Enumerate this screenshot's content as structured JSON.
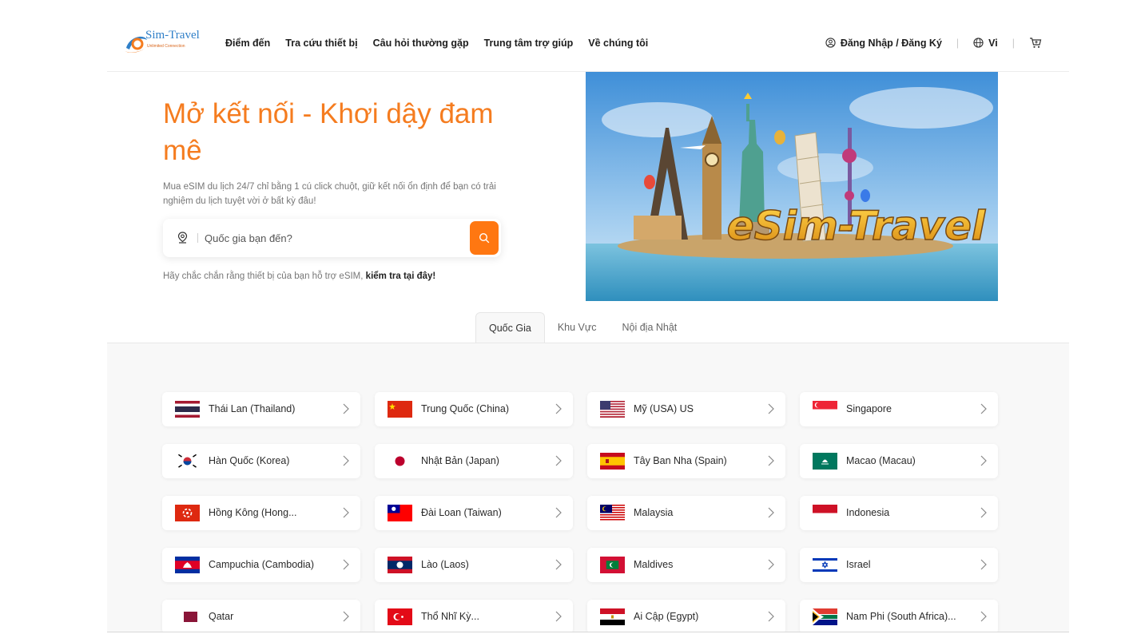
{
  "brand": {
    "name": "Sim-Travel",
    "tagline": "Unlimited Connection"
  },
  "nav": [
    "Điểm đến",
    "Tra cứu thiết bị",
    "Câu hỏi thường gặp",
    "Trung tâm trợ giúp",
    "Về chúng tôi"
  ],
  "header": {
    "login": "Đăng Nhập / Đăng Ký",
    "language": "Vi",
    "sep": "|"
  },
  "hero": {
    "title": "Mở kết nối - Khơi dậy đam mê",
    "description": "Mua eSIM du lịch 24/7 chỉ bằng 1 cú click chuột, giữ kết nối ổn định để bạn có trải nghiệm du lịch tuyệt vời ở bất kỳ đâu!",
    "search_placeholder": "Quốc gia bạn đến?",
    "hint_text": "Hãy chắc chắn rằng thiết bị của bạn hỗ trợ eSIM,",
    "hint_link": "kiểm tra tại đây!",
    "banner_text": "eSim-Travel"
  },
  "tabs": [
    {
      "label": "Quốc Gia",
      "active": true
    },
    {
      "label": "Khu Vực",
      "active": false
    },
    {
      "label": "Nội địa Nhật",
      "active": false
    }
  ],
  "countries": [
    {
      "name": "Thái Lan (Thailand)",
      "flag": "thailand-flag-icon"
    },
    {
      "name": "Trung Quốc (China)",
      "flag": "china-flag-icon"
    },
    {
      "name": "Mỹ (USA) US",
      "flag": "usa-flag-icon"
    },
    {
      "name": "Singapore",
      "flag": "singapore-flag-icon"
    },
    {
      "name": "Hàn Quốc (Korea)",
      "flag": "korea-flag-icon"
    },
    {
      "name": "Nhật Bản (Japan)",
      "flag": "japan-flag-icon"
    },
    {
      "name": "Tây Ban Nha (Spain)",
      "flag": "spain-flag-icon"
    },
    {
      "name": "Macao (Macau)",
      "flag": "macau-flag-icon"
    },
    {
      "name": "Hồng Kông (Hong...",
      "flag": "hongkong-flag-icon"
    },
    {
      "name": "Đài Loan (Taiwan)",
      "flag": "taiwan-flag-icon"
    },
    {
      "name": "Malaysia",
      "flag": "malaysia-flag-icon"
    },
    {
      "name": "Indonesia",
      "flag": "indonesia-flag-icon"
    },
    {
      "name": "Campuchia (Cambodia)",
      "flag": "cambodia-flag-icon"
    },
    {
      "name": "Lào (Laos)",
      "flag": "laos-flag-icon"
    },
    {
      "name": "Maldives",
      "flag": "maldives-flag-icon"
    },
    {
      "name": "Israel",
      "flag": "israel-flag-icon"
    },
    {
      "name": "Qatar",
      "flag": "qatar-flag-icon"
    },
    {
      "name": "Thổ Nhĩ Kỳ...",
      "flag": "turkey-flag-icon"
    },
    {
      "name": "Ai Cập (Egypt)",
      "flag": "egypt-flag-icon"
    },
    {
      "name": "Nam Phi (South Africa)...",
      "flag": "southafrica-flag-icon"
    }
  ],
  "colors": {
    "accent": "#ff7711",
    "title": "#f57c1f",
    "link_blue": "#2f7fc8"
  }
}
